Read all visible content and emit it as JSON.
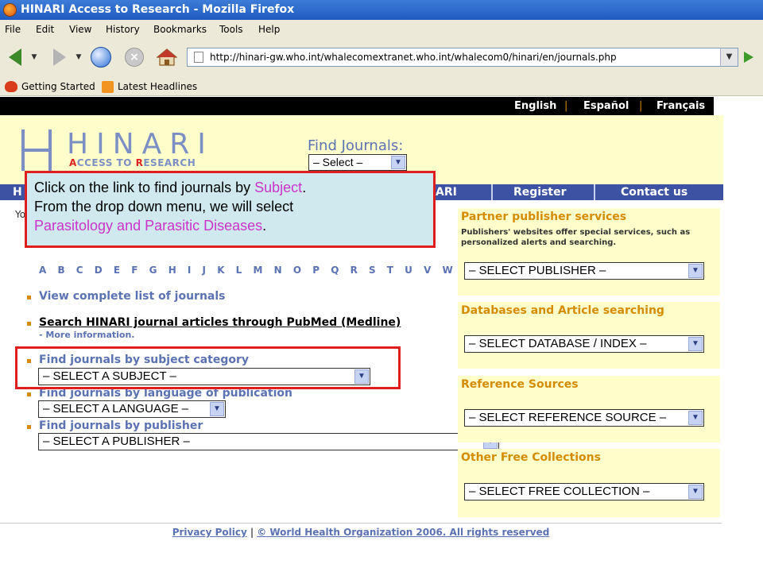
{
  "window": {
    "title": "HINARI Access to Research - Mozilla Firefox"
  },
  "menu": [
    "File",
    "Edit",
    "View",
    "History",
    "Bookmarks",
    "Tools",
    "Help"
  ],
  "address": {
    "url": "http://hinari-gw.who.int/whalecomextranet.who.int/whalecom0/hinari/en/journals.php"
  },
  "bookmarks": [
    "Getting Started",
    "Latest Headlines"
  ],
  "languages": [
    "English",
    "Español",
    "Français"
  ],
  "logo": {
    "title": "HINARI",
    "sub_a": "A",
    "sub_rest1": "CCESS TO ",
    "sub_r": "R",
    "sub_rest2": "ESEARCH"
  },
  "find_journals": {
    "label": "Find Journals:",
    "select": "– Select –"
  },
  "nav": {
    "left": "H",
    "mid": "ARI",
    "register": "Register",
    "contact": "Contact us"
  },
  "left": {
    "alpha": "A B C D E F G H I J K L M N O P Q R S T U V W X Y Z",
    "intro": "Yo",
    "view_all": "View complete list of journals",
    "pubmed": "Search HINARI journal articles through PubMed (Medline)",
    "more_info": "- More information.",
    "by_subject": "Find journals by subject category",
    "subject_select": "– SELECT A SUBJECT –",
    "by_language": "Find journals by language of publication",
    "language_select": "– SELECT A LANGUAGE –",
    "by_publisher": "Find journals by publisher",
    "publisher_select": "– SELECT A PUBLISHER –"
  },
  "right": {
    "partner_title": "Partner publisher services",
    "partner_desc1": "Publishers' websites offer special services, such as",
    "partner_desc2": "personalized alerts and searching.",
    "partner_select": "– SELECT PUBLISHER –",
    "db_title": "Databases and Article searching",
    "db_select": "– SELECT DATABASE / INDEX –",
    "ref_title": "Reference Sources",
    "ref_select": "– SELECT REFERENCE SOURCE –",
    "free_title": "Other Free Collections",
    "free_select": "– SELECT FREE COLLECTION –"
  },
  "footer": {
    "privacy": "Privacy Policy",
    "sep": "|",
    "copyright": "© World Health Organization 2006. All rights reserved"
  },
  "callout": {
    "l1a": "Click on the link to find journals by ",
    "l1b": "Subject",
    "l1c": ".",
    "l2": "From the drop down menu, we will select",
    "l3a": "Parasitology and Parasitic Diseases",
    "l3b": "."
  },
  "colors": {
    "accent": "#5b72b3",
    "orange": "#d48b00",
    "callout_border": "#e01e1e",
    "pink": "#cc33cc"
  }
}
